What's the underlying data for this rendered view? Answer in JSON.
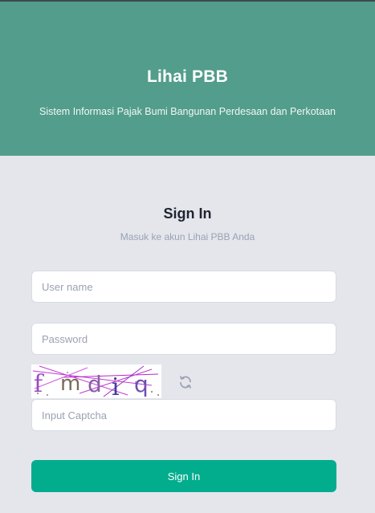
{
  "header": {
    "title": "Lihai PBB",
    "subtitle": "Sistem Informasi Pajak Bumi Bangunan Perdesaan dan Perkotaan",
    "background_color": "#529d8b"
  },
  "form": {
    "title": "Sign In",
    "subtitle": "Masuk ke akun Lihai PBB Anda",
    "username": {
      "placeholder": "User name",
      "value": ""
    },
    "password": {
      "placeholder": "Password",
      "value": ""
    },
    "captcha": {
      "image_text": "fmdiq",
      "input_placeholder": "Input Captcha",
      "refresh_icon": "refresh-icon"
    },
    "submit_label": "Sign In",
    "accent_color": "#02ad8e"
  }
}
